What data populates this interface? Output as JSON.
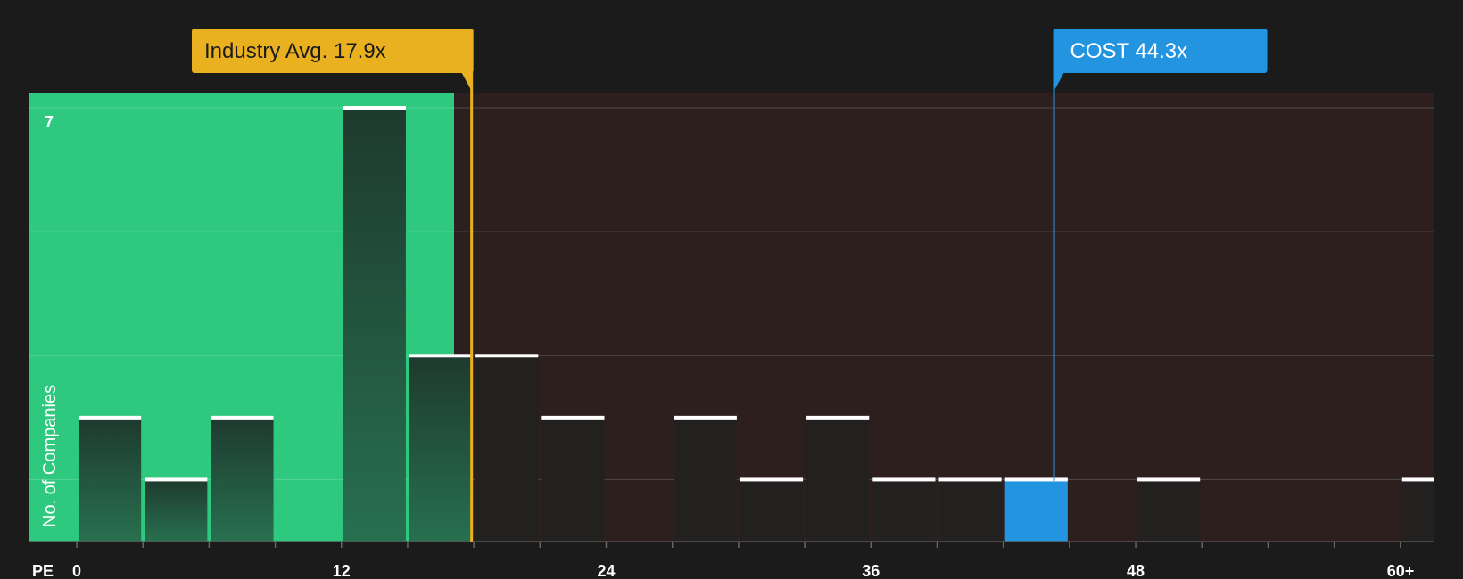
{
  "chart_data": {
    "type": "bar",
    "xlabel": "PE",
    "ylabel": "No. of Companies",
    "ylim": [
      0,
      7
    ],
    "y_top_tick": "7",
    "x_ticks": [
      0,
      12,
      24,
      36,
      48
    ],
    "x_tick_labels": [
      "0",
      "12",
      "24",
      "36",
      "48",
      "60+"
    ],
    "bin_width": 3,
    "bars": [
      {
        "x": 1.5,
        "value": 2
      },
      {
        "x": 4.5,
        "value": 1
      },
      {
        "x": 7.5,
        "value": 2
      },
      {
        "x": 13.5,
        "value": 7
      },
      {
        "x": 16.5,
        "value": 3
      },
      {
        "x": 19.5,
        "value": 3
      },
      {
        "x": 22.5,
        "value": 2
      },
      {
        "x": 28.5,
        "value": 2
      },
      {
        "x": 31.5,
        "value": 1
      },
      {
        "x": 34.5,
        "value": 2
      },
      {
        "x": 37.5,
        "value": 1
      },
      {
        "x": 40.5,
        "value": 1
      },
      {
        "x": 43.5,
        "value": 1,
        "highlight": true
      },
      {
        "x": 49.5,
        "value": 1
      },
      {
        "x": 61.5,
        "value": 1
      }
    ],
    "industry_avg": {
      "label": "Industry Avg. 17.9x",
      "value": 17.9
    },
    "company": {
      "label": "COST 44.3x",
      "value": 44.3
    },
    "colors": {
      "background": "#1b1b1b",
      "good_zone": "#2ec97f",
      "bad_zone": "#2e1f1f",
      "industry": "#e9b01f",
      "company": "#2394e0",
      "bar_dark": "#232020",
      "bar_cap": "#ffffff"
    }
  }
}
